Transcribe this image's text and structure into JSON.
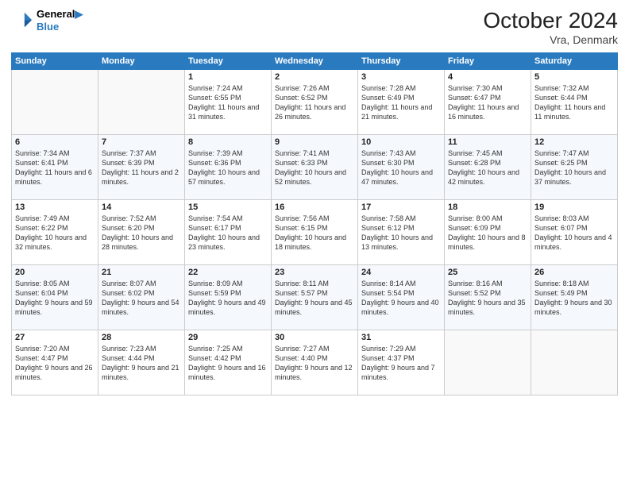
{
  "header": {
    "logo_line1": "General",
    "logo_line2": "Blue",
    "month": "October 2024",
    "location": "Vra, Denmark"
  },
  "weekdays": [
    "Sunday",
    "Monday",
    "Tuesday",
    "Wednesday",
    "Thursday",
    "Friday",
    "Saturday"
  ],
  "weeks": [
    [
      {
        "num": "",
        "sunrise": "",
        "sunset": "",
        "daylight": ""
      },
      {
        "num": "",
        "sunrise": "",
        "sunset": "",
        "daylight": ""
      },
      {
        "num": "1",
        "sunrise": "Sunrise: 7:24 AM",
        "sunset": "Sunset: 6:55 PM",
        "daylight": "Daylight: 11 hours and 31 minutes."
      },
      {
        "num": "2",
        "sunrise": "Sunrise: 7:26 AM",
        "sunset": "Sunset: 6:52 PM",
        "daylight": "Daylight: 11 hours and 26 minutes."
      },
      {
        "num": "3",
        "sunrise": "Sunrise: 7:28 AM",
        "sunset": "Sunset: 6:49 PM",
        "daylight": "Daylight: 11 hours and 21 minutes."
      },
      {
        "num": "4",
        "sunrise": "Sunrise: 7:30 AM",
        "sunset": "Sunset: 6:47 PM",
        "daylight": "Daylight: 11 hours and 16 minutes."
      },
      {
        "num": "5",
        "sunrise": "Sunrise: 7:32 AM",
        "sunset": "Sunset: 6:44 PM",
        "daylight": "Daylight: 11 hours and 11 minutes."
      }
    ],
    [
      {
        "num": "6",
        "sunrise": "Sunrise: 7:34 AM",
        "sunset": "Sunset: 6:41 PM",
        "daylight": "Daylight: 11 hours and 6 minutes."
      },
      {
        "num": "7",
        "sunrise": "Sunrise: 7:37 AM",
        "sunset": "Sunset: 6:39 PM",
        "daylight": "Daylight: 11 hours and 2 minutes."
      },
      {
        "num": "8",
        "sunrise": "Sunrise: 7:39 AM",
        "sunset": "Sunset: 6:36 PM",
        "daylight": "Daylight: 10 hours and 57 minutes."
      },
      {
        "num": "9",
        "sunrise": "Sunrise: 7:41 AM",
        "sunset": "Sunset: 6:33 PM",
        "daylight": "Daylight: 10 hours and 52 minutes."
      },
      {
        "num": "10",
        "sunrise": "Sunrise: 7:43 AM",
        "sunset": "Sunset: 6:30 PM",
        "daylight": "Daylight: 10 hours and 47 minutes."
      },
      {
        "num": "11",
        "sunrise": "Sunrise: 7:45 AM",
        "sunset": "Sunset: 6:28 PM",
        "daylight": "Daylight: 10 hours and 42 minutes."
      },
      {
        "num": "12",
        "sunrise": "Sunrise: 7:47 AM",
        "sunset": "Sunset: 6:25 PM",
        "daylight": "Daylight: 10 hours and 37 minutes."
      }
    ],
    [
      {
        "num": "13",
        "sunrise": "Sunrise: 7:49 AM",
        "sunset": "Sunset: 6:22 PM",
        "daylight": "Daylight: 10 hours and 32 minutes."
      },
      {
        "num": "14",
        "sunrise": "Sunrise: 7:52 AM",
        "sunset": "Sunset: 6:20 PM",
        "daylight": "Daylight: 10 hours and 28 minutes."
      },
      {
        "num": "15",
        "sunrise": "Sunrise: 7:54 AM",
        "sunset": "Sunset: 6:17 PM",
        "daylight": "Daylight: 10 hours and 23 minutes."
      },
      {
        "num": "16",
        "sunrise": "Sunrise: 7:56 AM",
        "sunset": "Sunset: 6:15 PM",
        "daylight": "Daylight: 10 hours and 18 minutes."
      },
      {
        "num": "17",
        "sunrise": "Sunrise: 7:58 AM",
        "sunset": "Sunset: 6:12 PM",
        "daylight": "Daylight: 10 hours and 13 minutes."
      },
      {
        "num": "18",
        "sunrise": "Sunrise: 8:00 AM",
        "sunset": "Sunset: 6:09 PM",
        "daylight": "Daylight: 10 hours and 8 minutes."
      },
      {
        "num": "19",
        "sunrise": "Sunrise: 8:03 AM",
        "sunset": "Sunset: 6:07 PM",
        "daylight": "Daylight: 10 hours and 4 minutes."
      }
    ],
    [
      {
        "num": "20",
        "sunrise": "Sunrise: 8:05 AM",
        "sunset": "Sunset: 6:04 PM",
        "daylight": "Daylight: 9 hours and 59 minutes."
      },
      {
        "num": "21",
        "sunrise": "Sunrise: 8:07 AM",
        "sunset": "Sunset: 6:02 PM",
        "daylight": "Daylight: 9 hours and 54 minutes."
      },
      {
        "num": "22",
        "sunrise": "Sunrise: 8:09 AM",
        "sunset": "Sunset: 5:59 PM",
        "daylight": "Daylight: 9 hours and 49 minutes."
      },
      {
        "num": "23",
        "sunrise": "Sunrise: 8:11 AM",
        "sunset": "Sunset: 5:57 PM",
        "daylight": "Daylight: 9 hours and 45 minutes."
      },
      {
        "num": "24",
        "sunrise": "Sunrise: 8:14 AM",
        "sunset": "Sunset: 5:54 PM",
        "daylight": "Daylight: 9 hours and 40 minutes."
      },
      {
        "num": "25",
        "sunrise": "Sunrise: 8:16 AM",
        "sunset": "Sunset: 5:52 PM",
        "daylight": "Daylight: 9 hours and 35 minutes."
      },
      {
        "num": "26",
        "sunrise": "Sunrise: 8:18 AM",
        "sunset": "Sunset: 5:49 PM",
        "daylight": "Daylight: 9 hours and 30 minutes."
      }
    ],
    [
      {
        "num": "27",
        "sunrise": "Sunrise: 7:20 AM",
        "sunset": "Sunset: 4:47 PM",
        "daylight": "Daylight: 9 hours and 26 minutes."
      },
      {
        "num": "28",
        "sunrise": "Sunrise: 7:23 AM",
        "sunset": "Sunset: 4:44 PM",
        "daylight": "Daylight: 9 hours and 21 minutes."
      },
      {
        "num": "29",
        "sunrise": "Sunrise: 7:25 AM",
        "sunset": "Sunset: 4:42 PM",
        "daylight": "Daylight: 9 hours and 16 minutes."
      },
      {
        "num": "30",
        "sunrise": "Sunrise: 7:27 AM",
        "sunset": "Sunset: 4:40 PM",
        "daylight": "Daylight: 9 hours and 12 minutes."
      },
      {
        "num": "31",
        "sunrise": "Sunrise: 7:29 AM",
        "sunset": "Sunset: 4:37 PM",
        "daylight": "Daylight: 9 hours and 7 minutes."
      },
      {
        "num": "",
        "sunrise": "",
        "sunset": "",
        "daylight": ""
      },
      {
        "num": "",
        "sunrise": "",
        "sunset": "",
        "daylight": ""
      }
    ]
  ]
}
